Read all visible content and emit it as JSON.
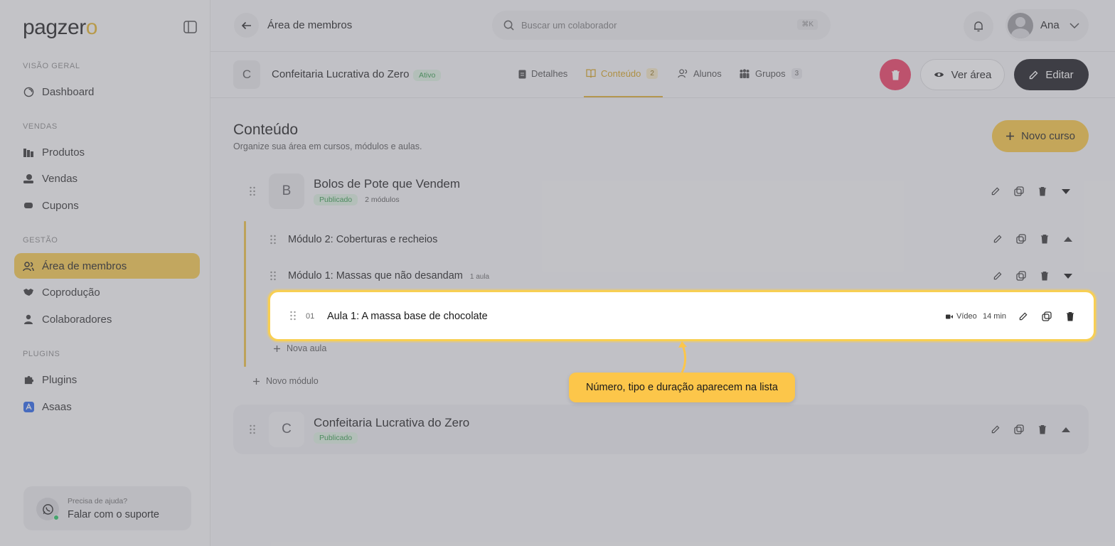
{
  "sidebar": {
    "logo_main": "pagzer",
    "logo_accent": "o",
    "sections": [
      {
        "label": "VISÃO GERAL",
        "items": [
          {
            "label": "Dashboard",
            "icon": "dashboard-icon"
          }
        ]
      },
      {
        "label": "VENDAS",
        "items": [
          {
            "label": "Produtos",
            "icon": "products-icon"
          },
          {
            "label": "Vendas",
            "icon": "sales-icon"
          },
          {
            "label": "Cupons",
            "icon": "coupon-icon"
          }
        ]
      },
      {
        "label": "GESTÃO",
        "items": [
          {
            "label": "Área de membros",
            "icon": "members-icon",
            "active": true
          },
          {
            "label": "Coprodução",
            "icon": "handshake-icon"
          },
          {
            "label": "Colaboradores",
            "icon": "user-icon"
          }
        ]
      },
      {
        "label": "PLUGINS",
        "items": [
          {
            "label": "Plugins",
            "icon": "puzzle-icon"
          },
          {
            "label": "Asaas",
            "icon": "asaas-logo-icon"
          }
        ]
      }
    ],
    "help": {
      "question": "Precisa de ajuda?",
      "link": "Falar com o suporte"
    }
  },
  "topbar": {
    "page_title": "Área de membros",
    "search_placeholder": "Buscar um colaborador",
    "search_shortcut": "⌘K",
    "user_name": "Ana"
  },
  "header": {
    "avatar_letter": "C",
    "area_name": "Confeitaria Lucrativa do Zero",
    "status": "Ativo",
    "tabs": [
      {
        "label": "Detalhes",
        "count": ""
      },
      {
        "label": "Conteúdo",
        "count": "2",
        "active": true
      },
      {
        "label": "Alunos",
        "count": ""
      },
      {
        "label": "Grupos",
        "count": "3"
      }
    ],
    "view_label": "Ver área",
    "edit_label": "Editar"
  },
  "content": {
    "title": "Conteúdo",
    "subtitle": "Organize sua área em cursos, módulos e aulas.",
    "new_course_label": "Novo curso",
    "courses": [
      {
        "letter": "B",
        "name": "Bolos de Pote que Vendem",
        "status": "Publicado",
        "modules_count": "2 módulos",
        "modules": [
          {
            "name": "Módulo 2: Coberturas e recheios",
            "count": ""
          },
          {
            "name": "Módulo 1: Massas que não desandam",
            "count": "1 aula",
            "lessons": [
              {
                "number": "01",
                "title": "Aula 1: A massa base de chocolate",
                "type": "Vídeo",
                "duration": "14 min"
              }
            ],
            "new_lesson_label": "Nova aula"
          }
        ],
        "new_module_label": "Novo módulo"
      },
      {
        "letter": "C",
        "name": "Confeitaria Lucrativa do Zero",
        "status": "Publicado"
      }
    ]
  },
  "tooltip": {
    "text": "Número, tipo e duração aparecem na lista"
  },
  "colors": {
    "accent": "#f8ca47",
    "danger": "#f03860",
    "published": "#2f9a47",
    "dark": "#16161a"
  }
}
